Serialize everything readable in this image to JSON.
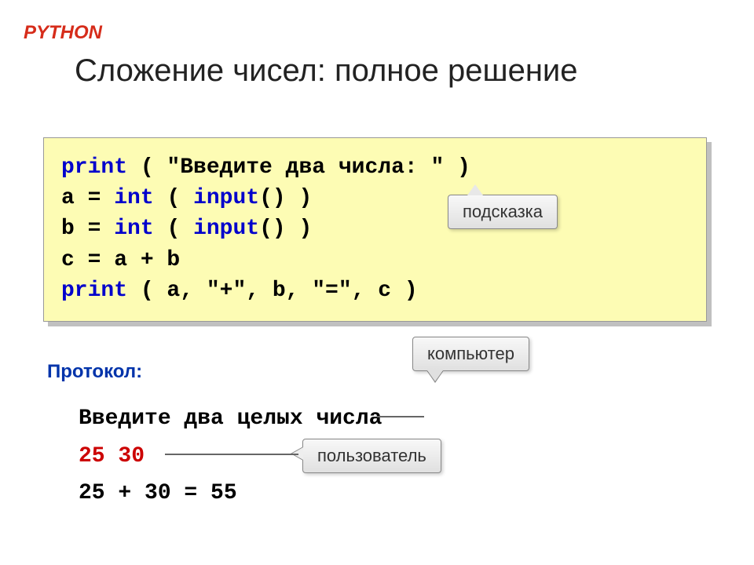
{
  "labels": {
    "python": "PYTHON",
    "title": "Сложение чисел: полное решение",
    "protocol": "Протокол:"
  },
  "code": {
    "line1": {
      "kw": "print",
      "text": " ( \"Введите два числа: \" )"
    },
    "line2": {
      "lhs": "a",
      "eq": " = ",
      "kw": "int",
      "paren_open": " ( ",
      "kw2": "input",
      "rest": "() )"
    },
    "line3": {
      "lhs": "b",
      "eq": " = ",
      "kw": "int",
      "paren_open": " ( ",
      "kw2": "input",
      "rest": "() )"
    },
    "line4": "c = a + b",
    "line5": {
      "kw": "print",
      "text": " ( a, \"+\", b, \"=\", c )"
    }
  },
  "callouts": {
    "hint": "подсказка",
    "computer": "компьютер",
    "user": "пользователь"
  },
  "protocol_output": {
    "prompt": "Введите два целых числа",
    "input": "25 30",
    "result": "25 + 30 = 55"
  }
}
